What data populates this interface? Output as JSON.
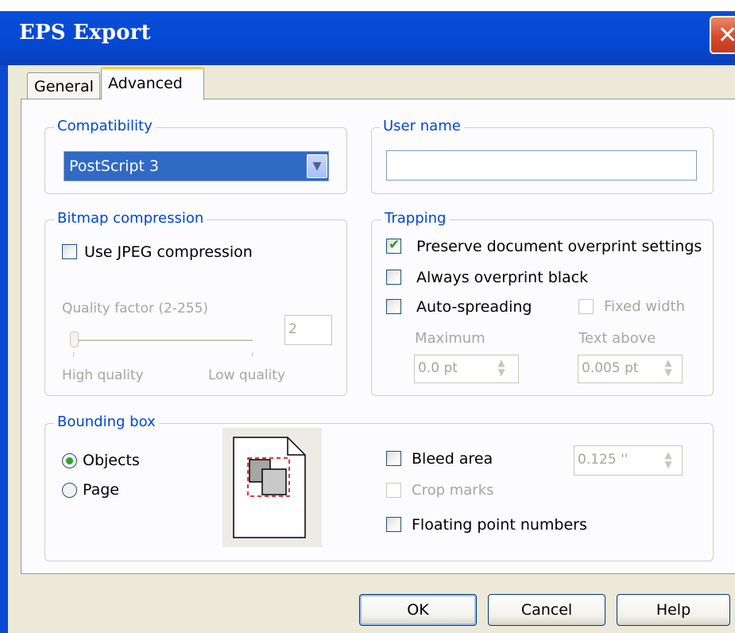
{
  "window": {
    "title": "EPS Export",
    "close_icon": "close-icon"
  },
  "tabs": [
    {
      "label": "General",
      "active": false
    },
    {
      "label": "Advanced",
      "active": true
    }
  ],
  "compatibility": {
    "legend": "Compatibility",
    "selected": "PostScript 3"
  },
  "user_name": {
    "legend": "User name",
    "value": ""
  },
  "bitmap_compression": {
    "legend": "Bitmap compression",
    "use_jpeg_label": "Use JPEG compression",
    "use_jpeg_checked": false,
    "quality_label": "Quality factor (2-255)",
    "quality_value": "2",
    "high_label": "High quality",
    "low_label": "Low quality"
  },
  "trapping": {
    "legend": "Trapping",
    "preserve_label": "Preserve document overprint settings",
    "preserve_checked": true,
    "overprint_black_label": "Always overprint black",
    "overprint_black_checked": false,
    "auto_spreading_label": "Auto-spreading",
    "auto_spreading_checked": false,
    "fixed_width_label": "Fixed width",
    "maximum_label": "Maximum",
    "maximum_value": "0.0 pt",
    "text_above_label": "Text above",
    "text_above_value": "0.005 pt"
  },
  "bounding_box": {
    "legend": "Bounding box",
    "objects_label": "Objects",
    "objects_selected": true,
    "page_label": "Page",
    "page_selected": false,
    "bleed_label": "Bleed area",
    "bleed_checked": false,
    "bleed_value": "0.125 ''",
    "crop_marks_label": "Crop marks",
    "floating_label": "Floating point numbers",
    "floating_checked": false
  },
  "buttons": {
    "ok": "OK",
    "cancel": "Cancel",
    "help": "Help"
  },
  "colors": {
    "accent": "#0046d5",
    "titlebar": "#0447d2",
    "selection": "#316ac5",
    "check": "#21a121"
  }
}
